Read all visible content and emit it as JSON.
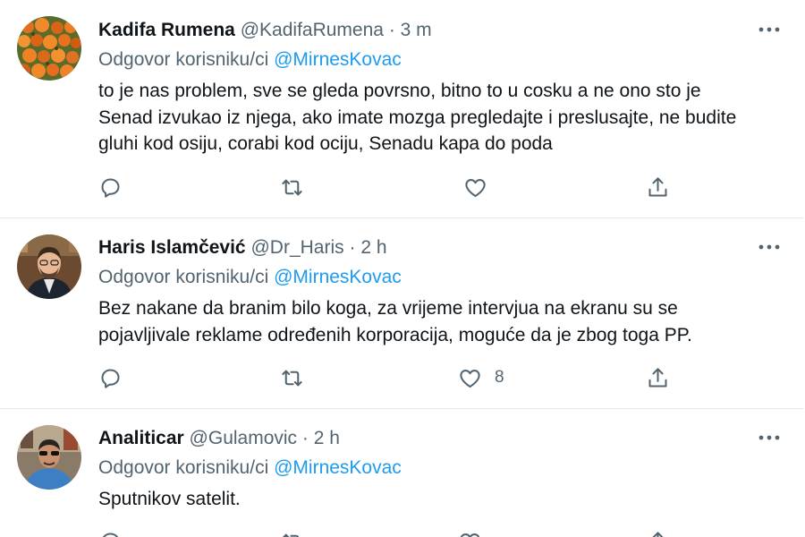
{
  "tweets": [
    {
      "name": "Kadifa Rumena",
      "handle": "@KadifaRumena",
      "separator": "·",
      "time": "3 m",
      "reply_prefix": "Odgovor korisniku/ci",
      "reply_mention": "@MirnesKovac",
      "text": "to je nas problem, sve se gleda povrsno, bitno to u cosku a ne ono sto je\nSenad izvukao iz njega, ako imate mozga pregledajte i preslusajte, ne budite\ngluhi kod osiju, corabi kod ociju, Senadu kapa do poda",
      "actions": {
        "reply_icon": "reply-icon",
        "retweet_icon": "retweet-icon",
        "like_icon": "heart-icon",
        "like_count": "",
        "share_icon": "share-icon"
      }
    },
    {
      "name": "Haris Islamčević",
      "handle": "@Dr_Haris",
      "separator": "·",
      "time": "2 h",
      "reply_prefix": "Odgovor korisniku/ci",
      "reply_mention": "@MirnesKovac",
      "text": "Bez nakane da branim bilo koga, za vrijeme intervjua na ekranu su se\npojavljivale reklame određenih korporacija, moguće da je zbog toga PP.",
      "actions": {
        "reply_icon": "reply-icon",
        "retweet_icon": "retweet-icon",
        "like_icon": "heart-icon",
        "like_count": "8",
        "share_icon": "share-icon"
      }
    },
    {
      "name": "Analiticar",
      "handle": "@Gulamovic",
      "separator": "·",
      "time": "2 h",
      "reply_prefix": "Odgovor korisniku/ci",
      "reply_mention": "@MirnesKovac",
      "text": "Sputnikov satelit.",
      "actions": {
        "reply_icon": "reply-icon",
        "retweet_icon": "retweet-icon",
        "like_icon": "heart-icon",
        "like_count": "",
        "share_icon": "share-icon"
      }
    }
  ],
  "colors": {
    "text": "#0f1419",
    "secondary": "#536471",
    "mention": "#1d9bf0",
    "divider": "#e3e8eb"
  }
}
